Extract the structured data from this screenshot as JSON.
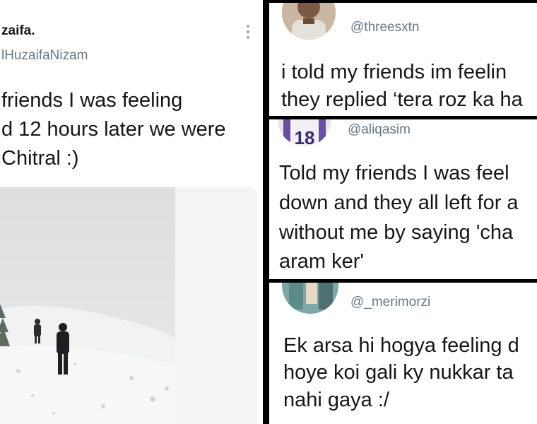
{
  "left_tweet": {
    "name": "zaifa.",
    "handle": "lHuzaifaNizam",
    "text_lines": [
      "friends I was feeling",
      "d 12 hours later we were",
      "Chitral :)"
    ]
  },
  "tweet_1": {
    "name": "",
    "handle": "@threesxtn",
    "text_lines": [
      "i told my friends im feelin",
      "they replied ‘tera roz ka ha"
    ]
  },
  "tweet_2": {
    "handle": "@aliqasim",
    "text_lines": [
      "Told my friends I was feel",
      "down and they all left for a",
      "without me by saying 'cha",
      "aram ker'"
    ]
  },
  "tweet_3": {
    "handle": "@_merimorzi",
    "text_lines": [
      "Ek arsa hi hogya feeling d",
      "hoye koi gali ky nukkar ta",
      "nahi gaya :/"
    ]
  },
  "icons": {
    "more": "more-vertical-icon"
  },
  "colors": {
    "text": "#14171a",
    "secondary": "#657786",
    "divider": "#000000"
  }
}
